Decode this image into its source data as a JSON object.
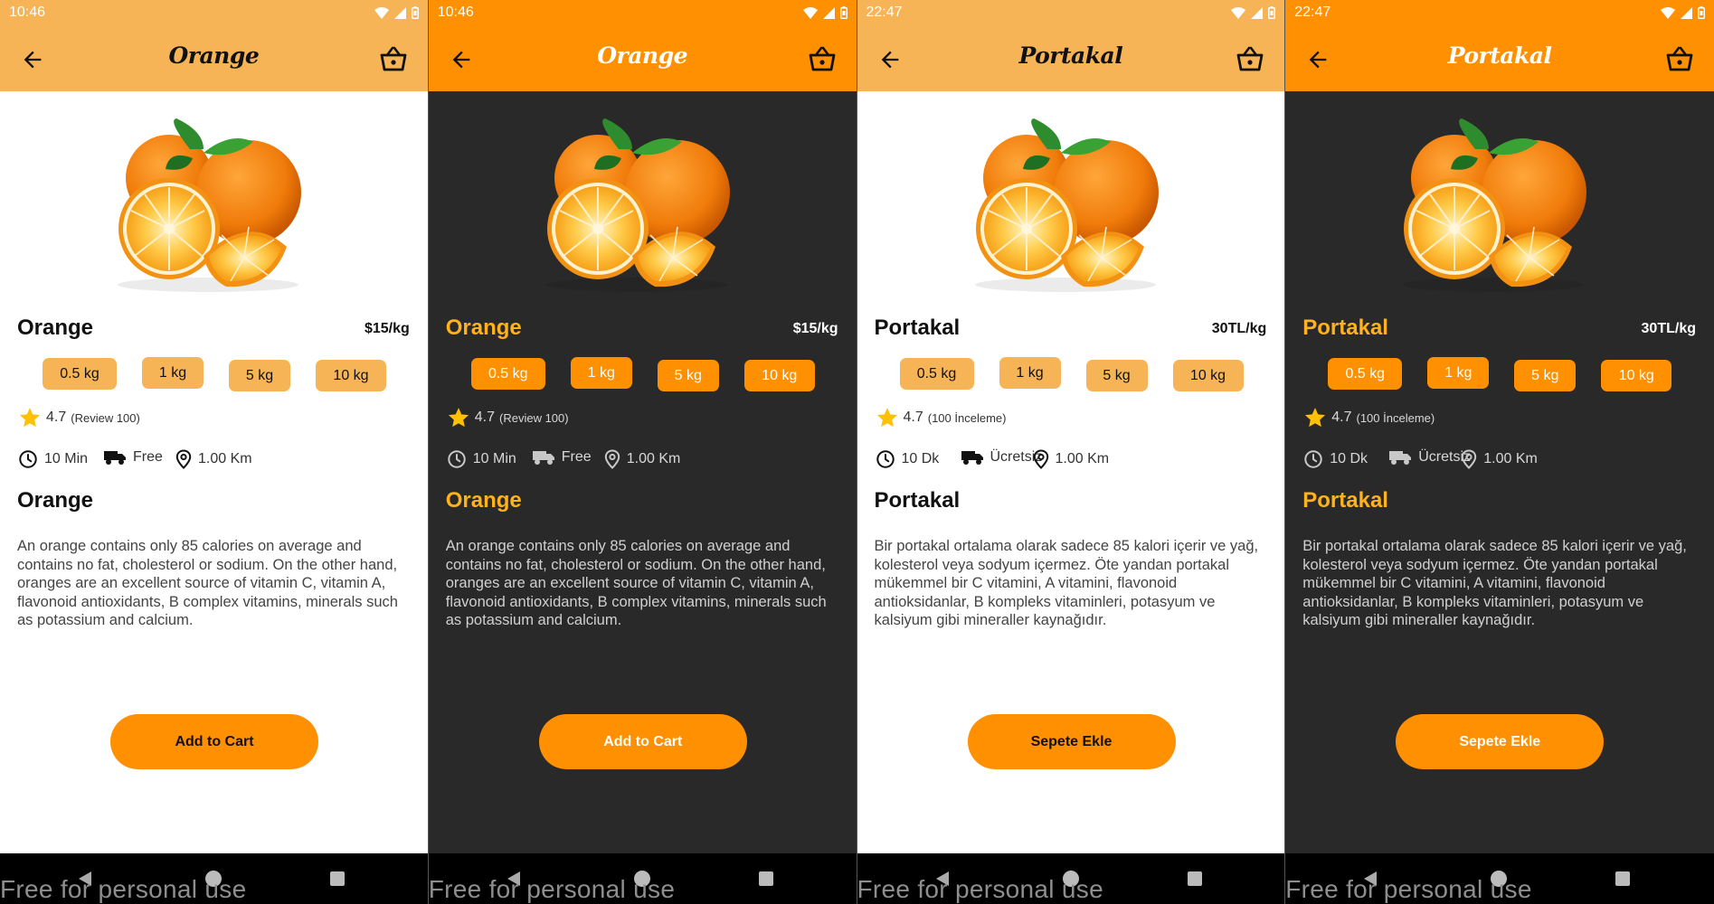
{
  "screens": [
    {
      "theme": "light",
      "status_time": "10:46",
      "title": "Orange",
      "product_name": "Orange",
      "price": "$15/kg",
      "weights": [
        "0.5 kg",
        "1 kg",
        "5 kg",
        "10 kg"
      ],
      "rating_value": "4.7",
      "rating_reviews": "(Review 100)",
      "time": "10 Min",
      "delivery": "Free",
      "distance": "1.00 Km",
      "subheading": "Orange",
      "description": "An orange contains only 85 calories on average and contains no fat, cholesterol or sodium. On the other hand, oranges are an excellent source of vitamin C, vitamin A, flavonoid antioxidants, B complex vitamins, minerals such as potassium and calcium.",
      "button": "Add to Cart",
      "watermark": "Free for personal use"
    },
    {
      "theme": "dark",
      "status_time": "10:46",
      "title": "Orange",
      "product_name": "Orange",
      "price": "$15/kg",
      "weights": [
        "0.5 kg",
        "1 kg",
        "5 kg",
        "10 kg"
      ],
      "rating_value": "4.7",
      "rating_reviews": "(Review 100)",
      "time": "10 Min",
      "delivery": "Free",
      "distance": "1.00 Km",
      "subheading": "Orange",
      "description": "An orange contains only 85 calories on average and contains no fat, cholesterol or sodium. On the other hand, oranges are an excellent source of vitamin C, vitamin A, flavonoid antioxidants, B complex vitamins, minerals such as potassium and calcium.",
      "button": "Add to Cart",
      "watermark": "Free for personal use"
    },
    {
      "theme": "light",
      "status_time": "22:47",
      "title": "Portakal",
      "product_name": "Portakal",
      "price": "30TL/kg",
      "weights": [
        "0.5 kg",
        "1 kg",
        "5 kg",
        "10 kg"
      ],
      "rating_value": "4.7",
      "rating_reviews": "(100 İnceleme)",
      "time": "10 Dk",
      "delivery": "Ücretsiz",
      "distance": "1.00 Km",
      "subheading": "Portakal",
      "description": "Bir portakal ortalama olarak sadece 85 kalori içerir ve yağ, kolesterol veya sodyum içermez. Öte yandan portakal mükemmel bir C vitamini, A vitamini, flavonoid antioksidanlar, B kompleks vitaminleri, potasyum ve kalsiyum gibi mineraller kaynağıdır.",
      "button": "Sepete Ekle",
      "watermark": "Free for personal use"
    },
    {
      "theme": "dark",
      "status_time": "22:47",
      "title": "Portakal",
      "product_name": "Portakal",
      "price": "30TL/kg",
      "weights": [
        "0.5 kg",
        "1 kg",
        "5 kg",
        "10 kg"
      ],
      "rating_value": "4.7",
      "rating_reviews": "(100 İnceleme)",
      "time": "10 Dk",
      "delivery": "Ücretsiz",
      "distance": "1.00 Km",
      "subheading": "Portakal",
      "description": "Bir portakal ortalama olarak sadece 85 kalori içerir ve yağ, kolesterol veya sodyum içermez. Öte yandan portakal mükemmel bir C vitamini, A vitamini, flavonoid antioksidanlar, B kompleks vitaminleri, potasyum ve kalsiyum gibi mineraller kaynağıdır.",
      "button": "Sepete Ekle",
      "watermark": "Free for personal use"
    }
  ],
  "icons": {
    "back": "arrow-left-icon",
    "cart": "basket-icon",
    "rating": "star-icon",
    "time": "clock-icon",
    "delivery": "truck-icon",
    "distance": "location-pin-icon",
    "fruit_image": "orange-fruit-image"
  },
  "colors": {
    "accent_orange": "#ff9001",
    "light_appbar": "#f6b456",
    "dark_background": "#2a2929",
    "dark_heading": "#ffb21c",
    "star": "#ffc107"
  }
}
